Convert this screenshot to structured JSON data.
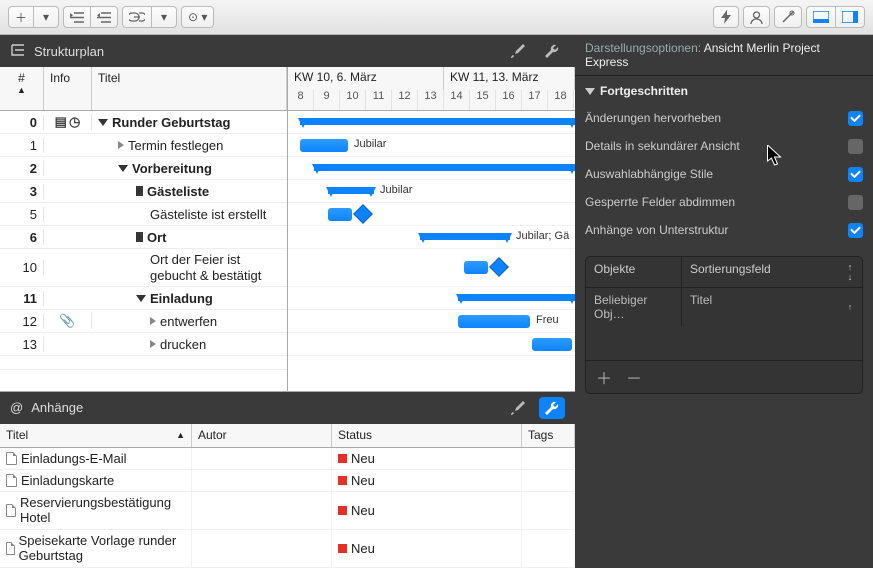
{
  "sections": {
    "structure_label": "Strukturplan",
    "attachments_label": "Anhänge"
  },
  "outline": {
    "head_num": "#",
    "head_info": "Info",
    "head_title": "Titel",
    "rows": [
      {
        "n": "0",
        "title": "Runder Geburtstag"
      },
      {
        "n": "1",
        "title": "Termin festlegen"
      },
      {
        "n": "2",
        "title": "Vorbereitung"
      },
      {
        "n": "3",
        "title": "Gästeliste"
      },
      {
        "n": "5",
        "title": "Gästeliste ist erstellt"
      },
      {
        "n": "6",
        "title": "Ort"
      },
      {
        "n": "10",
        "title": "Ort der Feier ist gebucht & bestätigt"
      },
      {
        "n": "11",
        "title": "Einladung"
      },
      {
        "n": "12",
        "title": "entwerfen"
      },
      {
        "n": "13",
        "title": "drucken"
      }
    ]
  },
  "timeline": {
    "weeks": [
      {
        "label": "KW 10, 6. März"
      },
      {
        "label": "KW 11, 13. März"
      }
    ],
    "days": [
      "8",
      "9",
      "10",
      "11",
      "12",
      "13",
      "14",
      "15",
      "16",
      "17",
      "18"
    ],
    "lbl_jubilar": "Jubilar",
    "lbl_jubilar2": "Jubilar",
    "lbl_jubilar_g": "Jubilar; Gä",
    "lbl_freu": "Freu"
  },
  "attachments": {
    "head_title": "Titel",
    "head_author": "Autor",
    "head_status": "Status",
    "head_tags": "Tags",
    "status_new": "Neu",
    "rows": [
      {
        "title": "Einladungs-E-Mail"
      },
      {
        "title": "Einladungskarte"
      },
      {
        "title": "Reservierungsbestätigung Hotel"
      },
      {
        "title": "Speisekarte Vorlage runder Geburtstag"
      }
    ]
  },
  "inspector": {
    "darstellung_lab": "Darstellungsoptionen:",
    "view_name": "Ansicht Merlin Project Express",
    "section": "Fortgeschritten",
    "o1": "Änderungen hervorheben",
    "o2": "Details in sekundärer Ansicht",
    "o3": "Auswahlabhängige Stile",
    "o4": "Gesperrte Felder abdimmen",
    "o5": "Anhänge von Unterstruktur",
    "tbl_objects": "Objekte",
    "tbl_sort": "Sortierungsfeld",
    "row_obj": "Beliebiger Obj…",
    "row_sort": "Titel"
  }
}
